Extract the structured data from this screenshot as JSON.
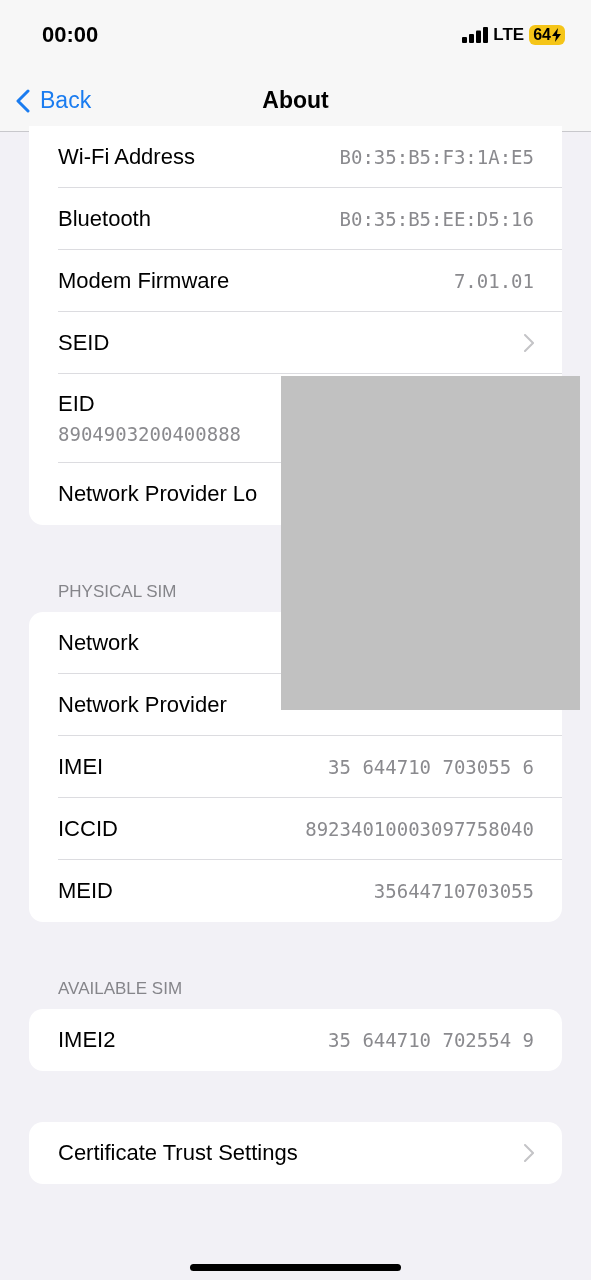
{
  "status_bar": {
    "time": "00:00",
    "network": "LTE",
    "battery": "64"
  },
  "nav": {
    "back": "Back",
    "title": "About"
  },
  "sections": [
    {
      "rows": [
        {
          "kind": "value",
          "label": "Wi-Fi Address",
          "value": "B0:35:B5:F3:1A:E5"
        },
        {
          "kind": "value",
          "label": "Bluetooth",
          "value": "B0:35:B5:EE:D5:16"
        },
        {
          "kind": "value",
          "label": "Modem Firmware",
          "value": "7.01.01"
        },
        {
          "kind": "chevron",
          "label": "SEID"
        },
        {
          "kind": "stacked",
          "label": "EID",
          "value": "8904903200400888"
        },
        {
          "kind": "value",
          "label": "Network Provider Lo"
        }
      ]
    },
    {
      "header": "PHYSICAL SIM",
      "rows": [
        {
          "kind": "value",
          "label": "Network"
        },
        {
          "kind": "value",
          "label": "Network Provider"
        },
        {
          "kind": "value",
          "label": "IMEI",
          "value": "35 644710 703055 6"
        },
        {
          "kind": "value",
          "label": "ICCID",
          "value": "89234010003097758040"
        },
        {
          "kind": "value",
          "label": "MEID",
          "value": "35644710703055"
        }
      ]
    },
    {
      "header": "AVAILABLE SIM",
      "rows": [
        {
          "kind": "value",
          "label": "IMEI2",
          "value": "35 644710 702554 9"
        }
      ]
    },
    {
      "rows": [
        {
          "kind": "chevron",
          "label": "Certificate Trust Settings"
        }
      ]
    }
  ],
  "redaction": {
    "kind": "block"
  }
}
